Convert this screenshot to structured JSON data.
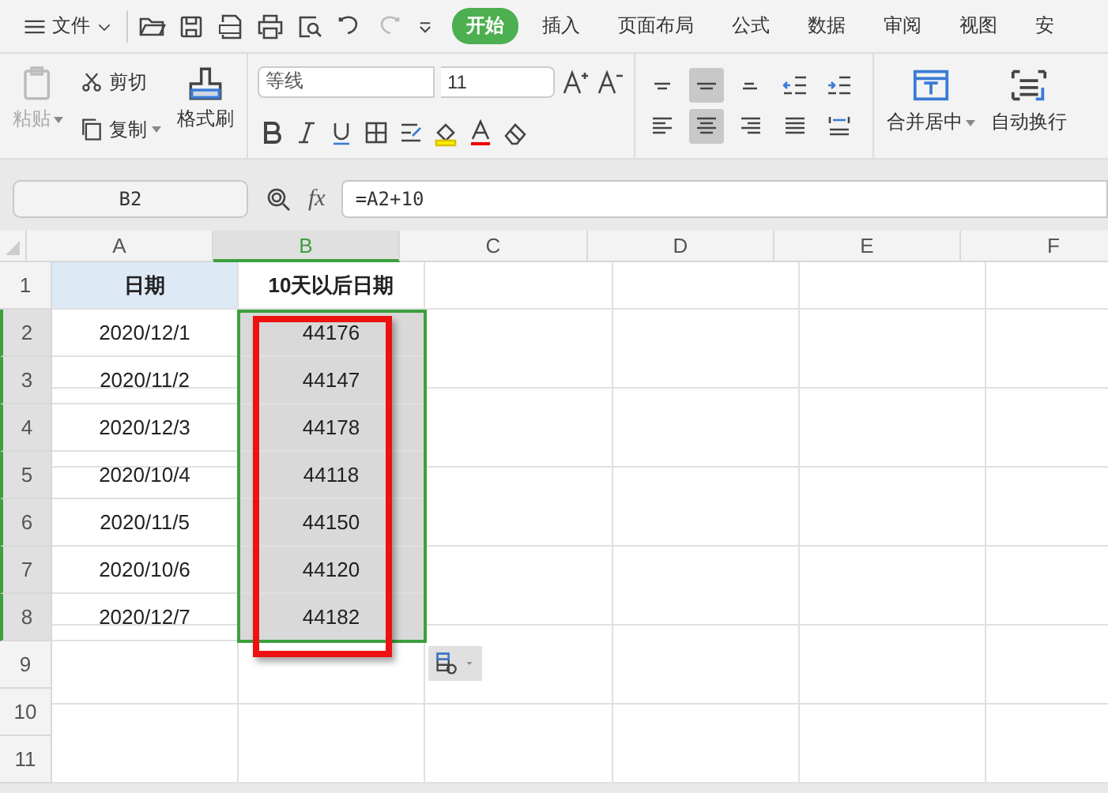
{
  "menu": {
    "label": "文件"
  },
  "tabs": [
    {
      "label": "开始",
      "selected": true
    },
    {
      "label": "插入",
      "selected": false
    },
    {
      "label": "页面布局",
      "selected": false
    },
    {
      "label": "公式",
      "selected": false
    },
    {
      "label": "数据",
      "selected": false
    },
    {
      "label": "审阅",
      "selected": false
    },
    {
      "label": "视图",
      "selected": false
    },
    {
      "label": "安",
      "selected": false
    }
  ],
  "clipboard": {
    "paste": {
      "label": "粘贴",
      "disabled": true
    },
    "cut": "剪切",
    "copy": "复制",
    "format_painter": "格式刷"
  },
  "font": {
    "name": "等线",
    "size": "11"
  },
  "align_buttons": [
    {
      "kind": "top",
      "selected": false
    },
    {
      "kind": "middle",
      "selected": true
    },
    {
      "kind": "bottom",
      "selected": false
    },
    {
      "kind": "outdent",
      "selected": false
    },
    {
      "kind": "indent",
      "selected": false
    },
    {
      "kind": "left",
      "selected": false
    },
    {
      "kind": "center",
      "selected": true
    },
    {
      "kind": "right",
      "selected": false
    },
    {
      "kind": "justify",
      "selected": false
    },
    {
      "kind": "distribute",
      "selected": false
    }
  ],
  "merge": "合并居中",
  "wrap": "自动换行",
  "name_box": "B2",
  "fx_label": "fx",
  "formula": "=A2+10",
  "columns": [
    {
      "label": "A",
      "selected": false
    },
    {
      "label": "B",
      "selected": true
    },
    {
      "label": "C",
      "selected": false
    },
    {
      "label": "D",
      "selected": false
    },
    {
      "label": "E",
      "selected": false
    },
    {
      "label": "F",
      "selected": false
    }
  ],
  "rows": [
    {
      "label": "1",
      "kind": "header",
      "selected": false,
      "cells": [
        "日期",
        "10天以后日期"
      ]
    },
    {
      "label": "2",
      "kind": "data",
      "selected": true,
      "cells": [
        "2020/12/1",
        "44176"
      ]
    },
    {
      "label": "3",
      "kind": "data",
      "selected": true,
      "cells": [
        "2020/11/2",
        "44147"
      ]
    },
    {
      "label": "4",
      "kind": "data",
      "selected": true,
      "cells": [
        "2020/12/3",
        "44178"
      ]
    },
    {
      "label": "5",
      "kind": "data",
      "selected": true,
      "cells": [
        "2020/10/4",
        "44118"
      ]
    },
    {
      "label": "6",
      "kind": "data",
      "selected": true,
      "cells": [
        "2020/11/5",
        "44150"
      ]
    },
    {
      "label": "7",
      "kind": "data",
      "selected": true,
      "cells": [
        "2020/10/6",
        "44120"
      ]
    },
    {
      "label": "8",
      "kind": "data",
      "selected": true,
      "cells": [
        "2020/12/7",
        "44182"
      ]
    },
    {
      "label": "9",
      "kind": "data",
      "selected": false,
      "cells": []
    },
    {
      "label": "10",
      "kind": "data",
      "selected": false,
      "cells": []
    },
    {
      "label": "11",
      "kind": "data",
      "selected": false,
      "cells": []
    }
  ],
  "annotation": {
    "kind": "rectangle"
  }
}
